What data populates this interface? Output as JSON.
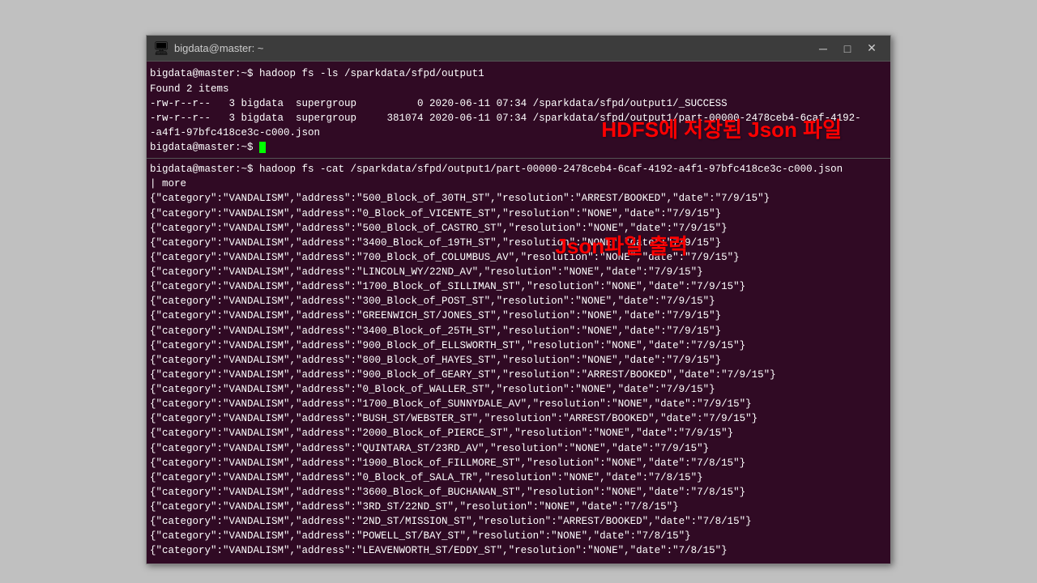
{
  "window": {
    "title": "bigdata@master: ~",
    "icon": "🖥",
    "minimize_label": "─",
    "maximize_label": "□",
    "close_label": "✕"
  },
  "terminal": {
    "top_section": {
      "command_line": "bigdata@master:~$ hadoop fs -ls /sparkdata/sfpd/output1",
      "found_line": "Found 2 items",
      "file1": "-rw-r--r--   3 bigdata  supergroup          0 2020-06-11 07:34 /sparkdata/sfpd/output1/_SUCCESS",
      "file2": "-rw-r--r--   3 bigdata  supergroup     381074 2020-06-11 07:34 /sparkdata/sfpd/output1/part-00000-2478ceb4-6caf-4192-",
      "file2_cont": "-a4f1-97bfc418ce3c-c000.json",
      "prompt_end": "bigdata@master:~$ "
    },
    "bottom_section": {
      "command_line": "bigdata@master:~$ hadoop fs -cat /sparkdata/sfpd/output1/part-00000-2478ceb4-6caf-4192-a4f1-97bfc418ce3c-c000.json",
      "pipe": "| more",
      "data_lines": [
        "{\"category\":\"VANDALISM\",\"address\":\"500_Block_of_30TH_ST\",\"resolution\":\"ARREST/BOOKED\",\"date\":\"7/9/15\"}",
        "{\"category\":\"VANDALISM\",\"address\":\"0_Block_of_VICENTE_ST\",\"resolution\":\"NONE\",\"date\":\"7/9/15\"}",
        "{\"category\":\"VANDALISM\",\"address\":\"500_Block_of_CASTRO_ST\",\"resolution\":\"NONE\",\"date\":\"7/9/15\"}",
        "{\"category\":\"VANDALISM\",\"address\":\"3400_Block_of_19TH_ST\",\"resolution\":\"NONE\",\"date\":\"7/9/15\"}",
        "{\"category\":\"VANDALISM\",\"address\":\"700_Block_of_COLUMBUS_AV\",\"resolution\":\"NONE\",\"date\":\"7/9/15\"}",
        "{\"category\":\"VANDALISM\",\"address\":\"LINCOLN_WY/22ND_AV\",\"resolution\":\"NONE\",\"date\":\"7/9/15\"}",
        "{\"category\":\"VANDALISM\",\"address\":\"1700_Block_of_SILLIMAN_ST\",\"resolution\":\"NONE\",\"date\":\"7/9/15\"}",
        "{\"category\":\"VANDALISM\",\"address\":\"300_Block_of_POST_ST\",\"resolution\":\"NONE\",\"date\":\"7/9/15\"}",
        "{\"category\":\"VANDALISM\",\"address\":\"GREENWICH_ST/JONES_ST\",\"resolution\":\"NONE\",\"date\":\"7/9/15\"}",
        "{\"category\":\"VANDALISM\",\"address\":\"3400_Block_of_25TH_ST\",\"resolution\":\"NONE\",\"date\":\"7/9/15\"}",
        "{\"category\":\"VANDALISM\",\"address\":\"900_Block_of_ELLSWORTH_ST\",\"resolution\":\"NONE\",\"date\":\"7/9/15\"}",
        "{\"category\":\"VANDALISM\",\"address\":\"800_Block_of_HAYES_ST\",\"resolution\":\"NONE\",\"date\":\"7/9/15\"}",
        "{\"category\":\"VANDALISM\",\"address\":\"900_Block_of_GEARY_ST\",\"resolution\":\"ARREST/BOOKED\",\"date\":\"7/9/15\"}",
        "{\"category\":\"VANDALISM\",\"address\":\"0_Block_of_WALLER_ST\",\"resolution\":\"NONE\",\"date\":\"7/9/15\"}",
        "{\"category\":\"VANDALISM\",\"address\":\"1700_Block_of_SUNNYDALE_AV\",\"resolution\":\"NONE\",\"date\":\"7/9/15\"}",
        "{\"category\":\"VANDALISM\",\"address\":\"BUSH_ST/WEBSTER_ST\",\"resolution\":\"ARREST/BOOKED\",\"date\":\"7/9/15\"}",
        "{\"category\":\"VANDALISM\",\"address\":\"2000_Block_of_PIERCE_ST\",\"resolution\":\"NONE\",\"date\":\"7/9/15\"}",
        "{\"category\":\"VANDALISM\",\"address\":\"QUINTARA_ST/23RD_AV\",\"resolution\":\"NONE\",\"date\":\"7/9/15\"}",
        "{\"category\":\"VANDALISM\",\"address\":\"1900_Block_of_FILLMORE_ST\",\"resolution\":\"NONE\",\"date\":\"7/8/15\"}",
        "{\"category\":\"VANDALISM\",\"address\":\"0_Block_of_SALA_TR\",\"resolution\":\"NONE\",\"date\":\"7/8/15\"}",
        "{\"category\":\"VANDALISM\",\"address\":\"3600_Block_of_BUCHANAN_ST\",\"resolution\":\"NONE\",\"date\":\"7/8/15\"}",
        "{\"category\":\"VANDALISM\",\"address\":\"3RD_ST/22ND_ST\",\"resolution\":\"NONE\",\"date\":\"7/8/15\"}",
        "{\"category\":\"VANDALISM\",\"address\":\"2ND_ST/MISSION_ST\",\"resolution\":\"ARREST/BOOKED\",\"date\":\"7/8/15\"}",
        "{\"category\":\"VANDALISM\",\"address\":\"POWELL_ST/BAY_ST\",\"resolution\":\"NONE\",\"date\":\"7/8/15\"}",
        "{\"category\":\"VANDALISM\",\"address\":\"LEAVENWORTH_ST/EDDY_ST\",\"resolution\":\"NONE\",\"date\":\"7/8/15\"}"
      ]
    },
    "overlay": {
      "hdfs_label": "HDFS에 저장된 Json 파일",
      "json_label": "Json파일 출력"
    }
  }
}
